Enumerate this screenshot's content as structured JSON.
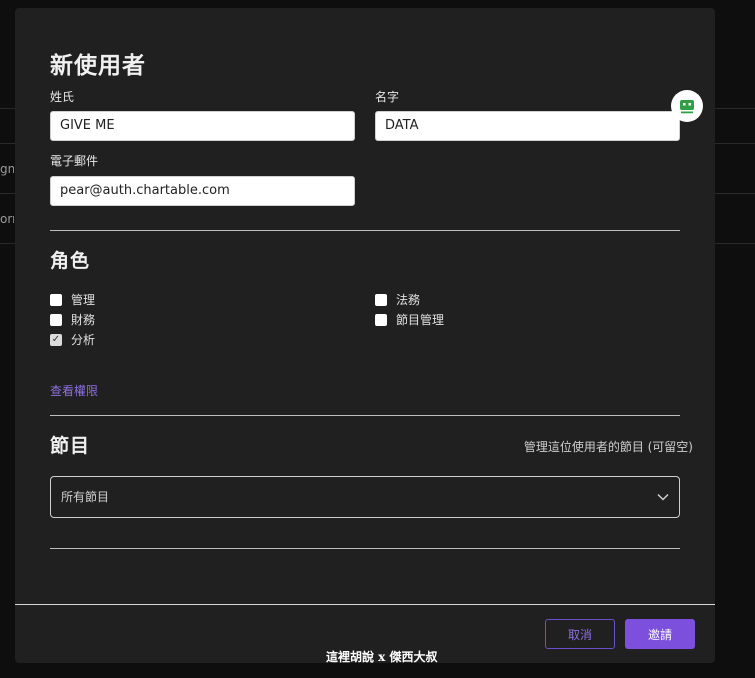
{
  "background": {
    "row_texts": [
      "gn",
      "orn"
    ]
  },
  "modal": {
    "title": "新使用者",
    "last_name": {
      "label": "姓氏",
      "value": "GIVE ME"
    },
    "first_name": {
      "label": "名字",
      "value": "DATA"
    },
    "email": {
      "label": "電子郵件",
      "value": "pear@auth.chartable.com"
    },
    "roles": {
      "title": "角色",
      "items": [
        {
          "label": "管理",
          "checked": false
        },
        {
          "label": "財務",
          "checked": false
        },
        {
          "label": "分析",
          "checked": true
        },
        {
          "label": "法務",
          "checked": false
        },
        {
          "label": "節目管理",
          "checked": false
        }
      ],
      "view_permissions": "查看權限"
    },
    "programs": {
      "title": "節目",
      "hint": "管理這位使用者的節目 (可留空)",
      "select_value": "所有節目"
    },
    "buttons": {
      "cancel": "取消",
      "invite": "邀請"
    }
  },
  "watermark": "這裡胡說 x 傑西大叔",
  "colors": {
    "accent": "#7c4fdc",
    "link": "#8e6fe0",
    "modal_bg": "#202021"
  },
  "icons": {
    "assistant": "robot-icon",
    "dropdown": "chevron-down-icon"
  }
}
